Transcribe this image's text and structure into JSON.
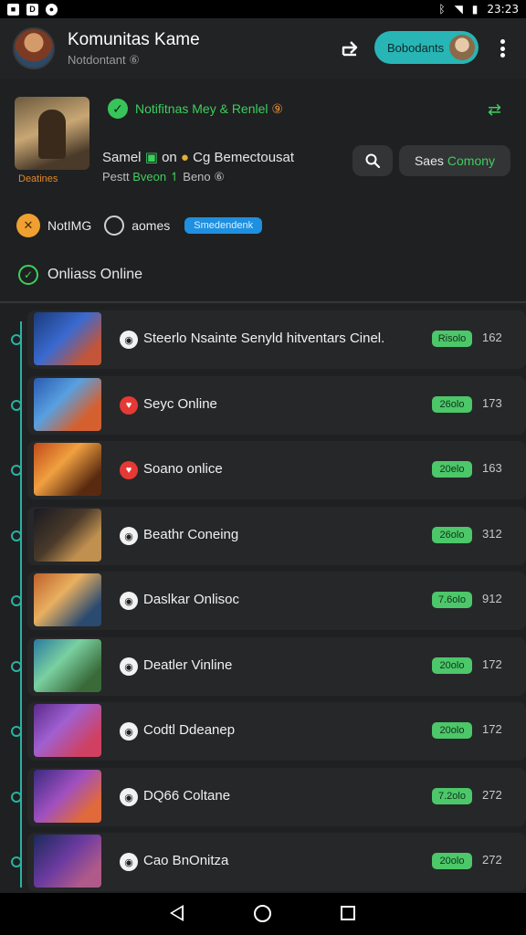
{
  "status_bar": {
    "time": "23:23"
  },
  "app_bar": {
    "title": "Komunitas Kame",
    "subtitle": "Notdontant ⑥",
    "status_pill_label": "Bobodants"
  },
  "header": {
    "game_name": "Deatines",
    "notification_title": "Notifitnas Mey & Renlel",
    "notification_suffix": "⑨",
    "info_line1_a": "Samel",
    "info_line1_b": "on",
    "info_line1_c": "Cg Bemectousat",
    "info_line2_a": "Pestt",
    "info_line2_b": "Bveon",
    "info_line2_c": "Beno",
    "info_line2_d": "⑥",
    "see_btn_a": "Saes",
    "see_btn_b": "Comony",
    "tag_label": "NotIMG",
    "games_label": "aomes",
    "blue_badge": "Smedendenk",
    "section_title": "Onliass Online"
  },
  "rows": [
    {
      "label": "Steerlo Nsainte Senyld hitventars Cinel.",
      "badge": "Risolo",
      "count": "162",
      "icon": "white"
    },
    {
      "label": "Seyc Online",
      "badge": "26olo",
      "count": "173",
      "icon": "red"
    },
    {
      "label": "Soano onlice",
      "badge": "20elo",
      "count": "163",
      "icon": "red"
    },
    {
      "label": "Beathr Coneing",
      "badge": "26olo",
      "count": "312",
      "icon": "white"
    },
    {
      "label": "Daslkar Onlisoc",
      "badge": "7.6olo",
      "count": "912",
      "icon": "white"
    },
    {
      "label": "Deatler Vinline",
      "badge": "20olo",
      "count": "172",
      "icon": "white"
    },
    {
      "label": "Codtl Ddeanep",
      "badge": "20olo",
      "count": "172",
      "icon": "white"
    },
    {
      "label": "DQ66 Coltane",
      "badge": "7.2olo",
      "count": "272",
      "icon": "white"
    },
    {
      "label": "Cao BnOnitza",
      "badge": "20olo",
      "count": "272",
      "icon": "white"
    }
  ],
  "colors": {
    "accent_teal": "#28b5b5",
    "accent_green": "#3ccf5e",
    "badge_green": "#4cc769",
    "badge_blue": "#1f8fe0",
    "alert_red": "#e53935"
  }
}
